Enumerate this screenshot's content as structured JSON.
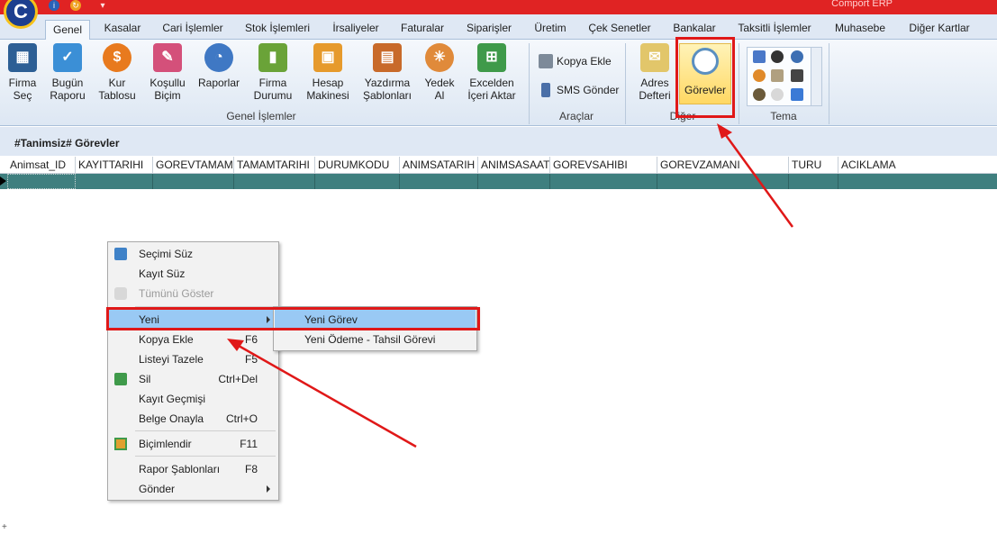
{
  "app": {
    "title": "Comport ERP"
  },
  "tabs": [
    {
      "label": "Genel",
      "active": true
    },
    {
      "label": "Kasalar"
    },
    {
      "label": "Cari İşlemler"
    },
    {
      "label": "Stok İşlemleri"
    },
    {
      "label": "İrsaliyeler"
    },
    {
      "label": "Faturalar"
    },
    {
      "label": "Siparişler"
    },
    {
      "label": "Üretim"
    },
    {
      "label": "Çek Senetler"
    },
    {
      "label": "Bankalar"
    },
    {
      "label": "Taksitli İşlemler"
    },
    {
      "label": "Muhasebe"
    },
    {
      "label": "Diğer Kartlar"
    }
  ],
  "ribbon": {
    "genel_buttons": [
      {
        "line1": "Firma",
        "line2": "Seç",
        "icon": "building-icon",
        "color": "#2d5f95"
      },
      {
        "line1": "Bugün",
        "line2": "Raporu",
        "icon": "calendar-icon",
        "color": "#3b8fd6"
      },
      {
        "line1": "Kur",
        "line2": "Tablosu",
        "icon": "dollar-icon",
        "color": "#e87a1e"
      },
      {
        "line1": "Koşullu",
        "line2": "Biçim",
        "icon": "paint-icon",
        "color": "#d4507a"
      },
      {
        "line1": "Raporlar",
        "line2": "",
        "icon": "pie-chart-icon",
        "color": "#3f78c4"
      },
      {
        "line1": "Firma",
        "line2": "Durumu",
        "icon": "bar-chart-icon",
        "color": "#6aa338"
      },
      {
        "line1": "Hesap",
        "line2": "Makinesi",
        "icon": "calculator-icon",
        "color": "#e69a2c"
      },
      {
        "line1": "Yazdırma",
        "line2": "Şablonları",
        "icon": "folder-icon",
        "color": "#c86a2a"
      },
      {
        "line1": "Yedek",
        "line2": "Al",
        "icon": "backup-icon",
        "color": "#e08a3a"
      },
      {
        "line1": "Excelden",
        "line2": "İçeri Aktar",
        "icon": "spreadsheet-icon",
        "color": "#3f9a4a"
      }
    ],
    "genel_group_label": "Genel İşlemler",
    "araclar": {
      "kopya": "Kopya Ekle",
      "sms": "SMS Gönder",
      "group_label": "Araçlar"
    },
    "diger": {
      "adres_line1": "Adres",
      "adres_line2": "Defteri",
      "gorevler": "Görevler",
      "group_label": "Diğer"
    },
    "tema": {
      "group_label": "Tema"
    }
  },
  "document": {
    "title": "#Tanimsiz# Görevler"
  },
  "grid": {
    "columns": [
      "Animsat_ID",
      "KAYITTARIHI",
      "GOREVTAMAM",
      "TAMAMTARIHI",
      "DURUMKODU",
      "ANIMSATARIH",
      "ANIMSASAAT",
      "GOREVSAHIBI",
      "GOREVZAMANI",
      "TURU",
      "ACIKLAMA"
    ]
  },
  "context_menu": {
    "items": [
      {
        "label": "Seçimi Süz",
        "shortcut": "",
        "icon": "filter-tree-icon"
      },
      {
        "label": "Kayıt Süz",
        "shortcut": ""
      },
      {
        "label": "Tümünü Göster",
        "shortcut": "",
        "disabled": true,
        "icon": "eraser-icon"
      },
      {
        "label": "Yeni",
        "shortcut": "",
        "submenu": true,
        "highlighted": true
      },
      {
        "label": "Kopya Ekle",
        "shortcut": "F6"
      },
      {
        "label": "Listeyi Tazele",
        "shortcut": "F5"
      },
      {
        "label": "Sil",
        "shortcut": "Ctrl+Del",
        "icon": "delete-icon"
      },
      {
        "label": "Kayıt Geçmişi",
        "shortcut": ""
      },
      {
        "label": "Belge Onayla",
        "shortcut": "Ctrl+O"
      },
      {
        "label": "Biçimlendir",
        "shortcut": "F11",
        "icon": "format-icon"
      },
      {
        "label": "Rapor Şablonları",
        "shortcut": "F8"
      },
      {
        "label": "Gönder",
        "shortcut": "",
        "submenu": true
      }
    ]
  },
  "submenu": {
    "items": [
      {
        "label": "Yeni Görev",
        "highlighted": true
      },
      {
        "label": "Yeni Ödeme - Tahsil Görevi"
      }
    ]
  },
  "colors": {
    "title_bar": "#e02323",
    "annotation_red": "#e01818",
    "selected_row": "#3f7f7f",
    "menu_highlight": "#99c9f4"
  }
}
